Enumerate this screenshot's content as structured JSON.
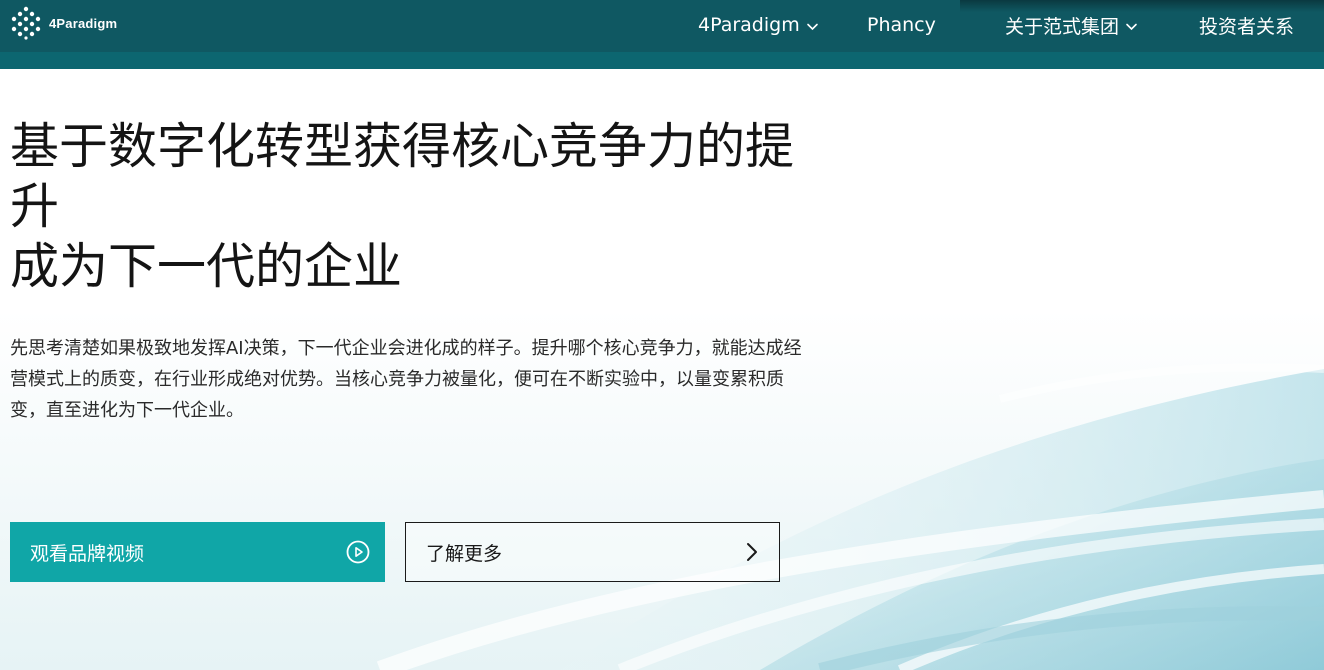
{
  "brand": {
    "name": "4Paradigm",
    "logo_icon": "dot-lattice-logo-icon"
  },
  "nav": {
    "items": [
      {
        "label": "4Paradigm",
        "has_dropdown": true
      },
      {
        "label": "Phancy",
        "has_dropdown": false
      },
      {
        "label": "关于范式集团",
        "has_dropdown": true
      },
      {
        "label": "投资者关系",
        "has_dropdown": false
      }
    ]
  },
  "hero": {
    "headline_lines": [
      "基于数字化转型获得核心竞争力的提",
      "升",
      "成为下一代的企业"
    ],
    "intro_lines": [
      "先思考清楚如果极致地发挥AI决策，下一代企业会进化成的样子。提升哪个核心竞争力，就能达成经",
      "营模式上的质变，在行业形成绝对优势。当核心竞争力被量化，便可在不断实验中，以量变累积质",
      "变，直至进化为下一代企业。"
    ],
    "primary_button": {
      "label": "观看品牌视频",
      "icon": "play-circle-icon"
    },
    "secondary_button": {
      "label": "了解更多",
      "icon": "chevron-right-icon"
    }
  },
  "colors": {
    "header_bg": "#0f5862",
    "header_strip": "#0c6670",
    "accent": "#10a6a7",
    "text": "#141414"
  }
}
